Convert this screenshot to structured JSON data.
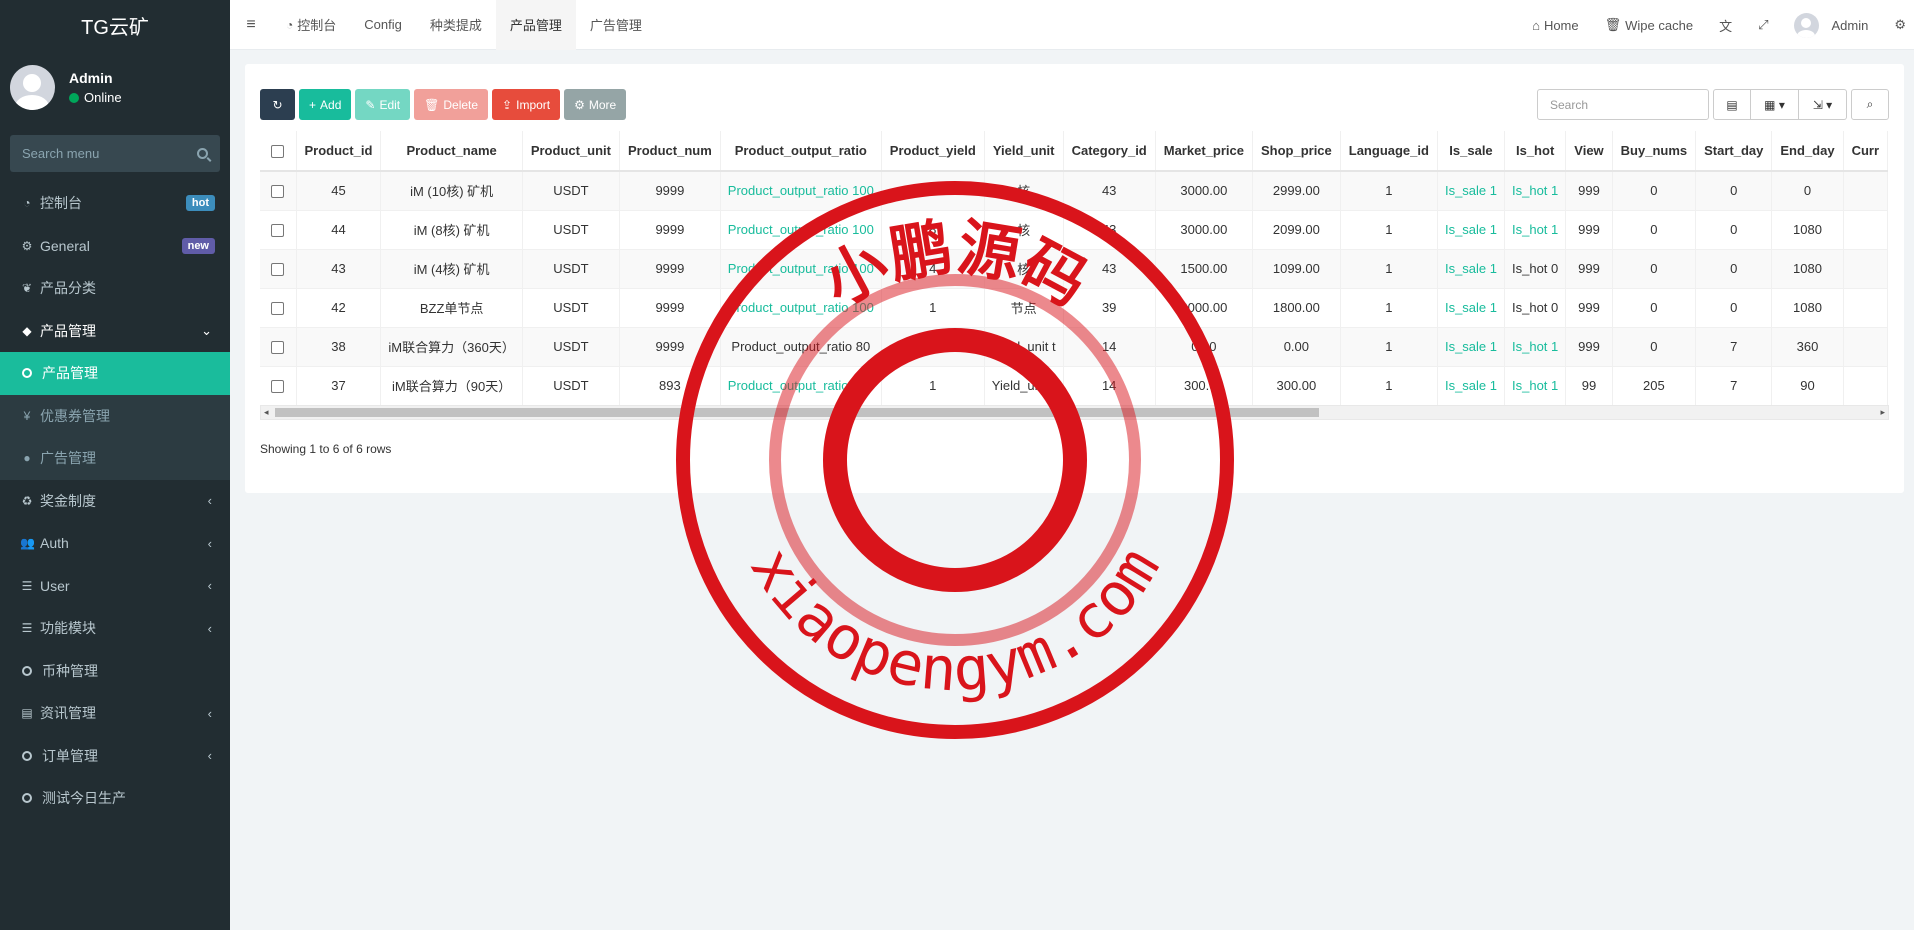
{
  "app": {
    "logo": "TG云矿"
  },
  "user_panel": {
    "name": "Admin",
    "status": "Online"
  },
  "sidebar": {
    "search_placeholder": "Search menu",
    "items": [
      {
        "label": "控制台",
        "badge": "hot"
      },
      {
        "label": "General",
        "badge": "new"
      },
      {
        "label": "产品分类"
      },
      {
        "label": "产品管理"
      },
      {
        "label": "产品管理"
      },
      {
        "label": "优惠券管理"
      },
      {
        "label": "广告管理"
      },
      {
        "label": "奖金制度"
      },
      {
        "label": "Auth"
      },
      {
        "label": "User"
      },
      {
        "label": "功能模块"
      },
      {
        "label": "币种管理"
      },
      {
        "label": "资讯管理"
      },
      {
        "label": "订单管理"
      },
      {
        "label": "测试今日生产"
      }
    ]
  },
  "topnav": {
    "tabs": [
      "控制台",
      "Config",
      "种类提成",
      "产品管理",
      "广告管理"
    ],
    "home": "Home",
    "wipe_cache": "Wipe cache",
    "admin": "Admin"
  },
  "toolbar": {
    "add": "Add",
    "edit": "Edit",
    "delete": "Delete",
    "import": "Import",
    "more": "More",
    "search_placeholder": "Search"
  },
  "table": {
    "columns": [
      "Product_id",
      "Product_name",
      "Product_unit",
      "Product_num",
      "Product_output_ratio",
      "Product_yield",
      "Yield_unit",
      "Category_id",
      "Market_price",
      "Shop_price",
      "Language_id",
      "Is_sale",
      "Is_hot",
      "View",
      "Buy_nums",
      "Start_day",
      "End_day",
      "Curr"
    ],
    "rows": [
      [
        "45",
        "iM (10核) 矿机",
        "USDT",
        "9999",
        "Product_output_ratio 100",
        "10",
        "核",
        "43",
        "3000.00",
        "2999.00",
        "1",
        "Is_sale 1",
        "Is_hot 1",
        "999",
        "0",
        "0",
        "0",
        ""
      ],
      [
        "44",
        "iM (8核) 矿机",
        "USDT",
        "9999",
        "Product_output_ratio 100",
        "8",
        "核",
        "43",
        "3000.00",
        "2099.00",
        "1",
        "Is_sale 1",
        "Is_hot 1",
        "999",
        "0",
        "0",
        "1080",
        ""
      ],
      [
        "43",
        "iM (4核) 矿机",
        "USDT",
        "9999",
        "Product_output_ratio 100",
        "4",
        "核",
        "43",
        "1500.00",
        "1099.00",
        "1",
        "Is_sale 1",
        "Is_hot 0",
        "999",
        "0",
        "0",
        "1080",
        ""
      ],
      [
        "42",
        "BZZ单节点",
        "USDT",
        "9999",
        "Product_output_ratio 100",
        "1",
        "节点",
        "39",
        "2000.00",
        "1800.00",
        "1",
        "Is_sale 1",
        "Is_hot 0",
        "999",
        "0",
        "0",
        "1080",
        ""
      ],
      [
        "38",
        "iM联合算力（360天）",
        "USDT",
        "9999",
        "Product_output_ratio 80",
        "1",
        "Yield_unit t",
        "14",
        "0.00",
        "0.00",
        "1",
        "Is_sale 1",
        "Is_hot 1",
        "999",
        "0",
        "7",
        "360",
        ""
      ],
      [
        "37",
        "iM联合算力（90天）",
        "USDT",
        "893",
        "Product_output_ratio 100",
        "1",
        "Yield_unit t",
        "14",
        "300.00",
        "300.00",
        "1",
        "Is_sale 1",
        "Is_hot 1",
        "99",
        "205",
        "7",
        "90",
        ""
      ]
    ],
    "link_flags": [
      [
        false,
        false,
        false,
        false,
        true,
        false,
        false,
        false,
        false,
        false,
        false,
        true,
        true,
        false,
        false,
        false,
        false,
        false
      ],
      [
        false,
        false,
        false,
        false,
        true,
        false,
        false,
        false,
        false,
        false,
        false,
        true,
        true,
        false,
        false,
        false,
        false,
        false
      ],
      [
        false,
        false,
        false,
        false,
        true,
        false,
        false,
        false,
        false,
        false,
        false,
        true,
        false,
        false,
        false,
        false,
        false,
        false
      ],
      [
        false,
        false,
        false,
        false,
        true,
        false,
        false,
        false,
        false,
        false,
        false,
        true,
        false,
        false,
        false,
        false,
        false,
        false
      ],
      [
        false,
        false,
        false,
        false,
        false,
        false,
        false,
        false,
        false,
        false,
        false,
        true,
        true,
        false,
        false,
        false,
        false,
        false
      ],
      [
        false,
        false,
        false,
        false,
        true,
        false,
        false,
        false,
        false,
        false,
        false,
        true,
        true,
        false,
        false,
        false,
        false,
        false
      ]
    ]
  },
  "footer": {
    "showing": "Showing 1 to 6 of 6 rows"
  },
  "watermark": {
    "top_text": "小鹏源码",
    "bottom_text": "xiaopengym.com"
  },
  "colors": {
    "accent": "#18bc9c",
    "sidebar_bg": "#222d32",
    "stamp": "#d9141b"
  }
}
